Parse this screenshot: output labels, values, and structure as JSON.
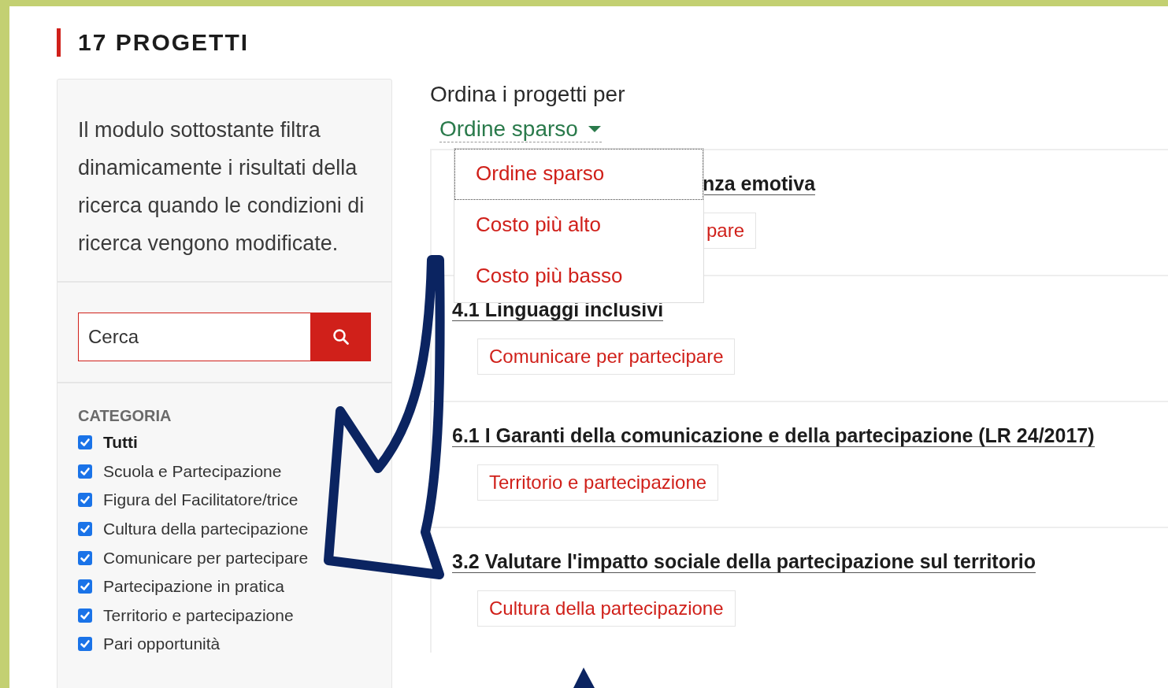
{
  "heading": "17 PROGETTI",
  "intro": "Il modulo sottostante filtra dinamicamente i risultati della ricerca quando le condizioni di ricerca vengono modificate.",
  "search": {
    "placeholder": "Cerca"
  },
  "category": {
    "title": "CATEGORIA",
    "options": [
      {
        "label": "Tutti",
        "checked": true,
        "kind": "all"
      },
      {
        "label": "Scuola e Partecipazione",
        "checked": true,
        "kind": "item"
      },
      {
        "label": "Figura del Facilitatore/trice",
        "checked": true,
        "kind": "item"
      },
      {
        "label": "Cultura della partecipazione",
        "checked": true,
        "kind": "item"
      },
      {
        "label": "Comunicare per partecipare",
        "checked": true,
        "kind": "item"
      },
      {
        "label": "Partecipazione in pratica",
        "checked": true,
        "kind": "item"
      },
      {
        "label": "Territorio e partecipazione",
        "checked": true,
        "kind": "item"
      },
      {
        "label": "Pari opportunità",
        "checked": true,
        "kind": "item"
      }
    ]
  },
  "sort": {
    "label": "Ordina i progetti per",
    "value": "Ordine sparso",
    "expanded": true,
    "options": [
      {
        "label": "Ordine sparso",
        "selected": true
      },
      {
        "label": "Costo più alto",
        "selected": false
      },
      {
        "label": "Costo più basso",
        "selected": false
      }
    ]
  },
  "projects": [
    {
      "title": "nza emotiva",
      "tag": "pare",
      "kind": "covered"
    },
    {
      "title": "4.1 Linguaggi inclusivi",
      "tag": "Comunicare per partecipare",
      "kind": "full"
    },
    {
      "title": "6.1 I Garanti della comunicazione e della partecipazione (LR 24/2017)",
      "tag": "Territorio e partecipazione",
      "kind": "full"
    },
    {
      "title": "3.2 Valutare l'impatto sociale della partecipazione sul territorio",
      "tag": "Cultura della partecipazione",
      "kind": "full"
    }
  ]
}
